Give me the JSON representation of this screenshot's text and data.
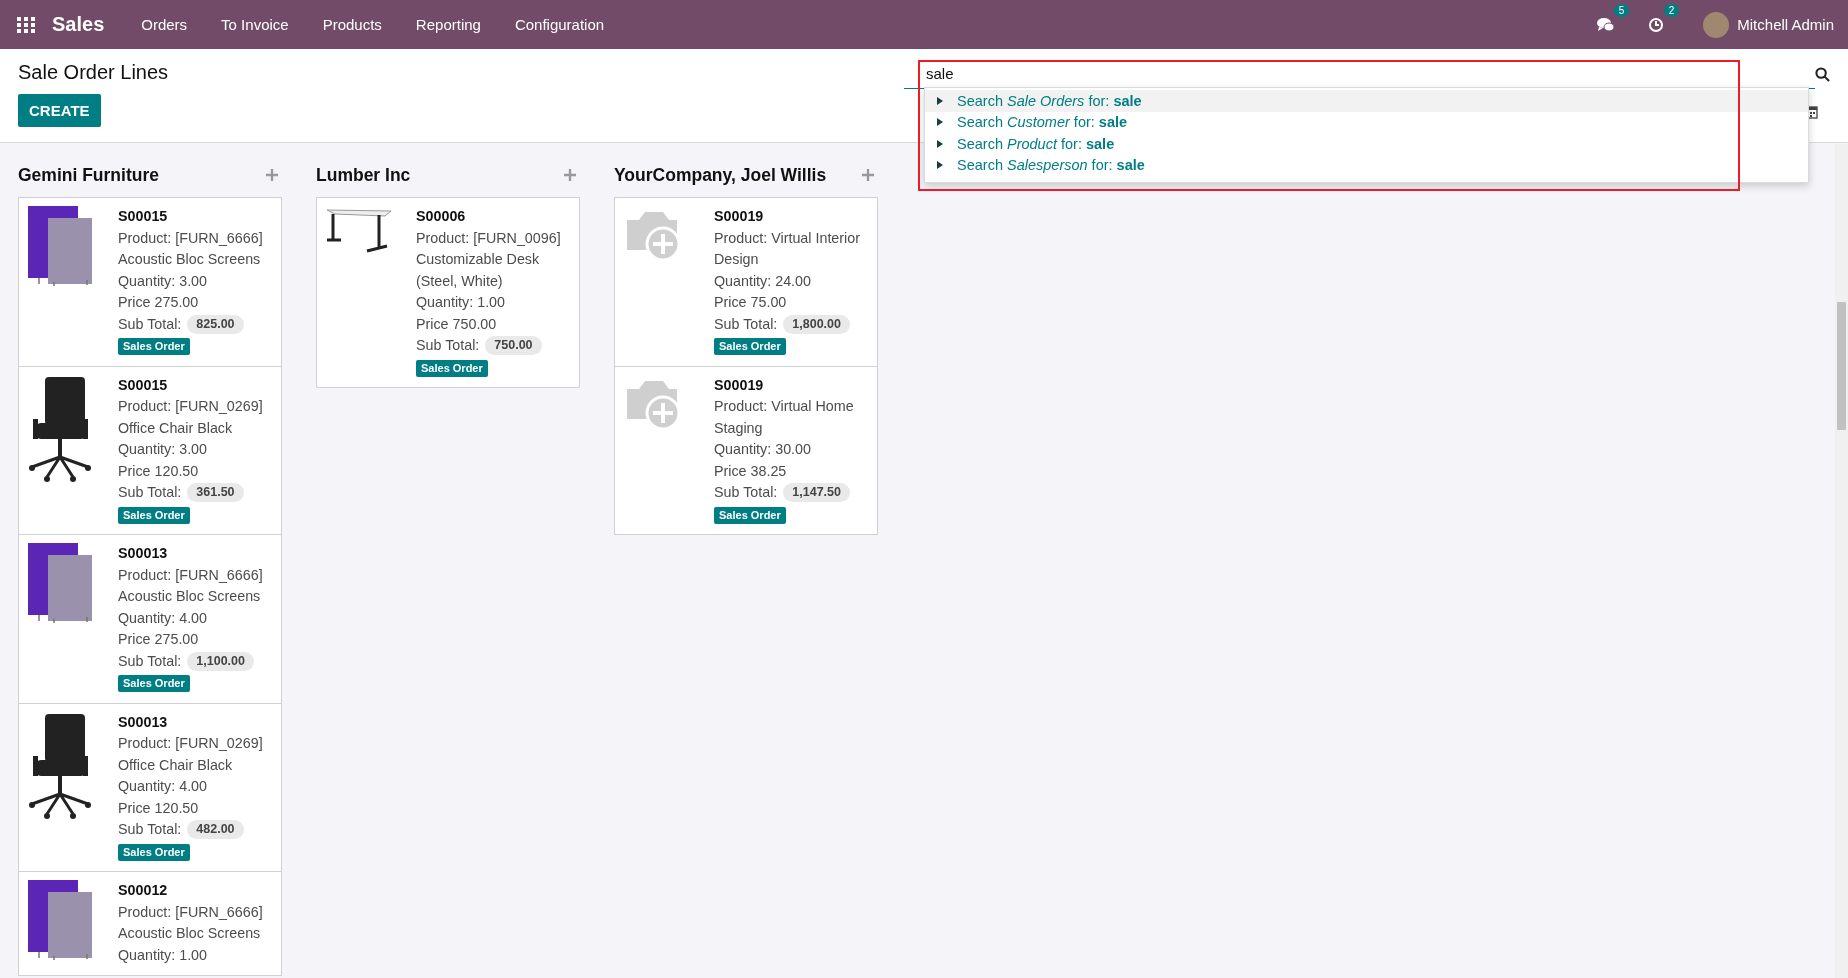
{
  "navbar": {
    "app": "Sales",
    "menu": [
      {
        "label": "Orders"
      },
      {
        "label": "To Invoice"
      },
      {
        "label": "Products"
      },
      {
        "label": "Reporting"
      },
      {
        "label": "Configuration"
      }
    ],
    "messages_count": "5",
    "activities_count": "2",
    "user": "Mitchell Admin"
  },
  "page": {
    "title": "Sale Order Lines",
    "create_button": "CREATE"
  },
  "search": {
    "value": "sale",
    "highlighted": true,
    "suggestions": [
      {
        "text": "Search *Sale Orders* for: **sale**",
        "selected": true
      },
      {
        "text": "Search *Customer* for: **sale**",
        "selected": false
      },
      {
        "text": "Search *Product* for: **sale**",
        "selected": false
      },
      {
        "text": "Search *Salesperson* for: **sale**",
        "selected": false
      }
    ]
  },
  "columns": [
    {
      "title": "Gemini Furniture",
      "cards": [
        {
          "kind": "screens",
          "ref": "S00015",
          "product": "Product: [FURN_6666] Acoustic Bloc Screens",
          "quantity": "Quantity: 3.00",
          "price": "Price 275.00",
          "subtotal_label": "Sub Total:",
          "subtotal": "825.00",
          "tag": "Sales Order"
        },
        {
          "kind": "chair",
          "ref": "S00015",
          "product": "Product: [FURN_0269] Office Chair Black",
          "quantity": "Quantity: 3.00",
          "price": "Price 120.50",
          "subtotal_label": "Sub Total:",
          "subtotal": "361.50",
          "tag": "Sales Order"
        },
        {
          "kind": "screens",
          "ref": "S00013",
          "product": "Product: [FURN_6666] Acoustic Bloc Screens",
          "quantity": "Quantity: 4.00",
          "price": "Price 275.00",
          "subtotal_label": "Sub Total:",
          "subtotal": "1,100.00",
          "tag": "Sales Order"
        },
        {
          "kind": "chair",
          "ref": "S00013",
          "product": "Product: [FURN_0269] Office Chair Black",
          "quantity": "Quantity: 4.00",
          "price": "Price 120.50",
          "subtotal_label": "Sub Total:",
          "subtotal": "482.00",
          "tag": "Sales Order"
        },
        {
          "kind": "screens",
          "ref": "S00012",
          "product": "Product: [FURN_6666] Acoustic Bloc Screens",
          "quantity": "Quantity: 1.00"
        }
      ]
    },
    {
      "title": "Lumber Inc",
      "cards": [
        {
          "kind": "desk",
          "ref": "S00006",
          "product": "Product: [FURN_0096] Customizable Desk (Steel, White)",
          "quantity": "Quantity: 1.00",
          "price": "Price 750.00",
          "subtotal_label": "Sub Total:",
          "subtotal": "750.00",
          "tag": "Sales Order"
        }
      ]
    },
    {
      "title": "YourCompany, Joel Willis",
      "cards": [
        {
          "kind": "placeholder",
          "ref": "S00019",
          "product": "Product: Virtual Interior Design",
          "quantity": "Quantity: 24.00",
          "price": "Price 75.00",
          "subtotal_label": "Sub Total:",
          "subtotal": "1,800.00",
          "tag": "Sales Order"
        },
        {
          "kind": "placeholder",
          "ref": "S00019",
          "product": "Product: Virtual Home Staging",
          "quantity": "Quantity: 30.00",
          "price": "Price 38.25",
          "subtotal_label": "Sub Total:",
          "subtotal": "1,147.50",
          "tag": "Sales Order"
        }
      ]
    }
  ]
}
